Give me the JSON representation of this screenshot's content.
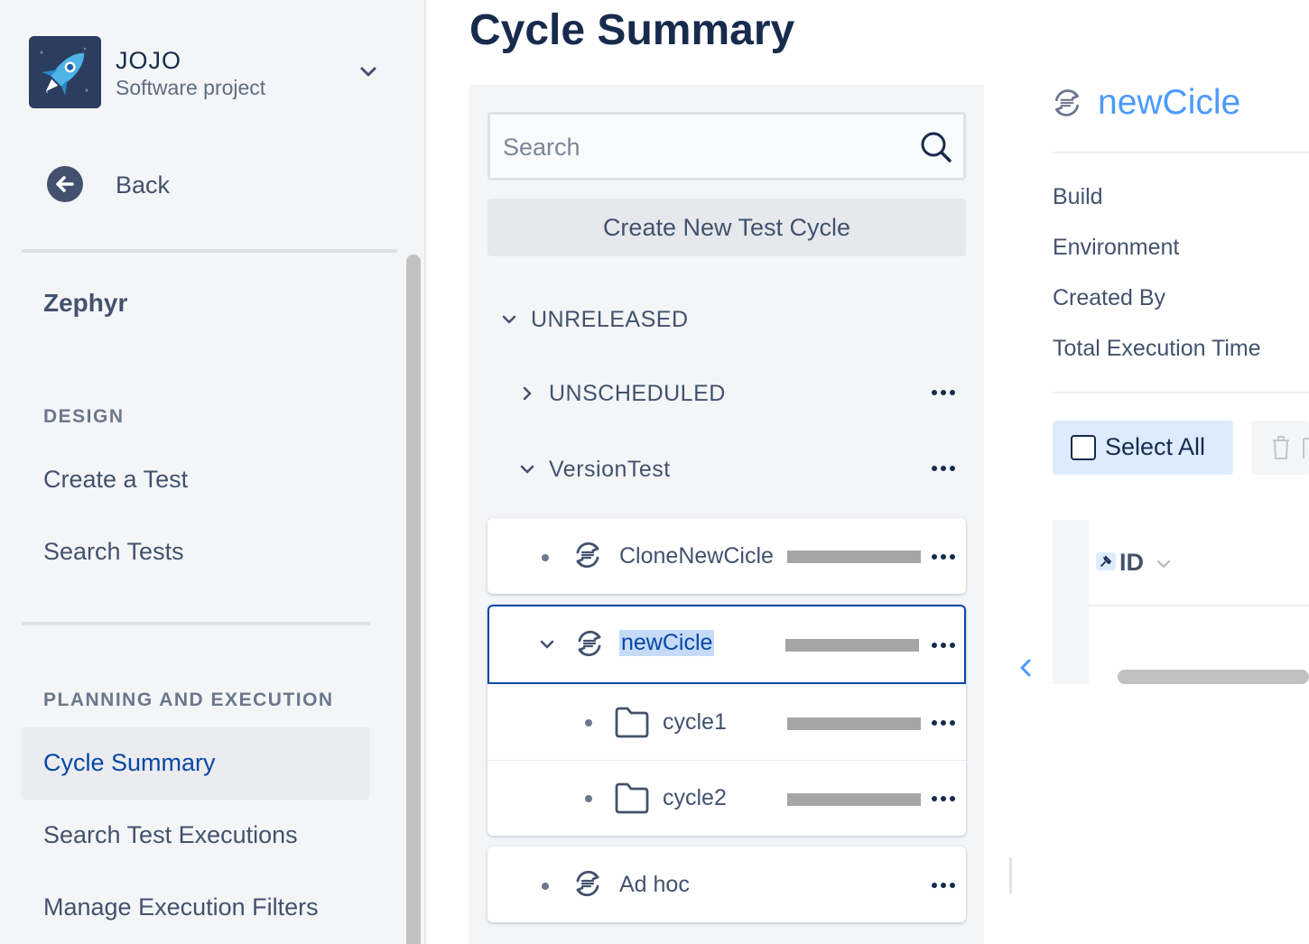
{
  "sidebar": {
    "project": {
      "name": "JOJO",
      "type": "Software project"
    },
    "back_label": "Back",
    "app_title": "Zephyr",
    "sections": [
      {
        "title": "DESIGN",
        "items": [
          "Create a Test",
          "Search Tests"
        ]
      },
      {
        "title": "PLANNING AND EXECUTION",
        "items": [
          "Cycle Summary",
          "Search Test Executions",
          "Manage Execution Filters"
        ]
      }
    ],
    "active_item": "Cycle Summary"
  },
  "main": {
    "title": "Cycle Summary",
    "search": {
      "placeholder": "Search",
      "value": ""
    },
    "create_button": "Create New Test Cycle",
    "tree": {
      "release_group": "UNRELEASED",
      "versions": [
        "UNSCHEDULED",
        "VersionTest"
      ],
      "cycles": [
        {
          "name": "CloneNewCicle",
          "selected": false
        },
        {
          "name": "newCicle",
          "selected": true,
          "folders": [
            "cycle1",
            "cycle2"
          ]
        },
        {
          "name": "Ad hoc",
          "selected": false
        }
      ]
    }
  },
  "detail": {
    "title": "newCicle",
    "fields": [
      "Build",
      "Environment",
      "Created By",
      "Total Execution Time"
    ],
    "select_all_label": "Select All",
    "column_header": "ID"
  },
  "colors": {
    "accent": "#0747a6",
    "link": "#4c9aff",
    "selection": "#c5dbf8",
    "sidebar_bg": "#f4f5f7"
  },
  "icons": [
    "rocket-icon",
    "chevron-down-icon",
    "arrow-left-icon",
    "search-icon",
    "chevron-right-icon",
    "more-icon",
    "cycle-icon",
    "folder-icon",
    "checkbox-icon",
    "trash-icon",
    "pin-icon",
    "chevron-left-icon"
  ]
}
